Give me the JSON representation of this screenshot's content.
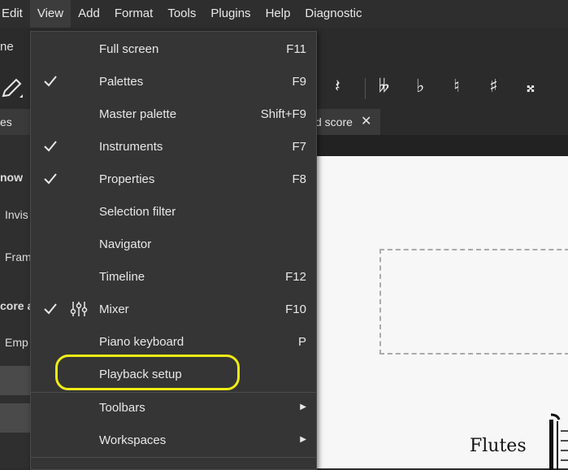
{
  "menubar": {
    "items": [
      {
        "label": "Edit"
      },
      {
        "label": "View"
      },
      {
        "label": "Add"
      },
      {
        "label": "Format"
      },
      {
        "label": "Tools"
      },
      {
        "label": "Plugins"
      },
      {
        "label": "Help"
      },
      {
        "label": "Diagnostic"
      }
    ]
  },
  "home_tab_partial": "ne",
  "toolbar": {
    "glyphs": [
      "𝄽",
      "𝄫",
      "♭",
      "♮",
      "♯",
      "𝄪"
    ]
  },
  "left_panel": {
    "tab_partial": "es",
    "lines": [
      "now",
      "Invis",
      "Fram",
      "core a",
      "Emp"
    ]
  },
  "score_tab": {
    "label_partial": "d score",
    "close_glyph": "✕"
  },
  "view_menu": {
    "items": [
      {
        "label": "Full screen",
        "shortcut": "F11",
        "checked": false
      },
      {
        "label": "Palettes",
        "shortcut": "F9",
        "checked": true
      },
      {
        "label": "Master palette",
        "shortcut": "Shift+F9",
        "checked": false
      },
      {
        "label": "Instruments",
        "shortcut": "F7",
        "checked": true
      },
      {
        "label": "Properties",
        "shortcut": "F8",
        "checked": true
      },
      {
        "label": "Selection filter",
        "shortcut": "",
        "checked": false
      },
      {
        "label": "Navigator",
        "shortcut": "",
        "checked": false
      },
      {
        "label": "Timeline",
        "shortcut": "F12",
        "checked": false
      },
      {
        "label": "Mixer",
        "shortcut": "F10",
        "checked": true,
        "icon": "mixer-icon"
      },
      {
        "label": "Piano keyboard",
        "shortcut": "P",
        "checked": false
      },
      {
        "label": "Playback setup",
        "shortcut": "",
        "checked": false,
        "highlighted": true
      }
    ],
    "submenus": [
      {
        "label": "Toolbars",
        "arrow": "▶"
      },
      {
        "label": "Workspaces",
        "arrow": "▶"
      }
    ]
  },
  "score": {
    "instrument_label": "Flutes"
  },
  "colors": {
    "highlight": "#f0ec14",
    "menu_bg": "#353535"
  }
}
